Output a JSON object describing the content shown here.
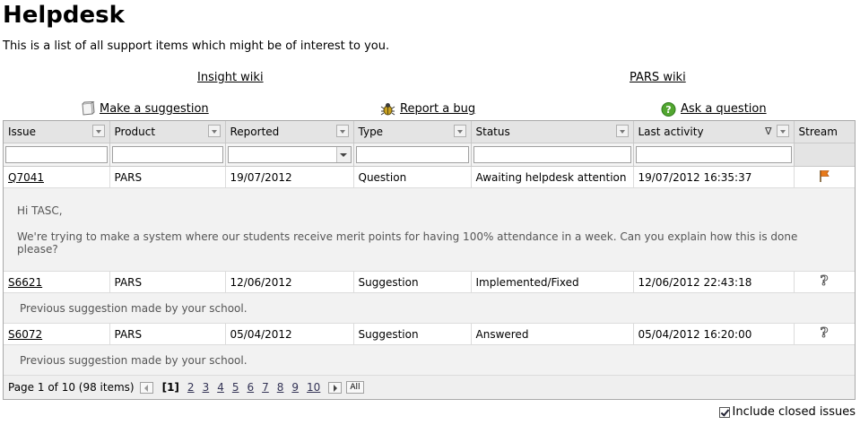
{
  "page": {
    "title": "Helpdesk",
    "intro": "This is a list of all support items which might be of interest to you."
  },
  "links": {
    "insight_wiki": "Insight wiki",
    "pars_wiki": "PARS wiki"
  },
  "actions": {
    "suggestion": "Make a suggestion",
    "bug": "Report a bug",
    "question": "Ask a question"
  },
  "columns": {
    "issue": "Issue",
    "product": "Product",
    "reported": "Reported",
    "type": "Type",
    "status": "Status",
    "last_activity": "Last activity",
    "stream": "Stream"
  },
  "sort_indicator": "∇",
  "rows": [
    {
      "issue": "Q7041",
      "product": "PARS",
      "reported": "19/07/2012",
      "type": "Question",
      "status": "Awaiting helpdesk attention",
      "last_activity": "19/07/2012 16:35:37",
      "stream_icon": "flag-icon",
      "detail_line1": "Hi TASC,",
      "detail_line2": "We're trying to make a system where our students receive merit points for having 100% attendance in a week. Can you explain how this is done please?"
    },
    {
      "issue": "S6621",
      "product": "PARS",
      "reported": "12/06/2012",
      "type": "Suggestion",
      "status": "Implemented/Fixed",
      "last_activity": "12/06/2012 22:43:18",
      "stream_icon": "question-mark-icon",
      "detail": "Previous suggestion made by your school."
    },
    {
      "issue": "S6072",
      "product": "PARS",
      "reported": "05/04/2012",
      "type": "Suggestion",
      "status": "Answered",
      "last_activity": "05/04/2012 16:20:00",
      "stream_icon": "question-mark-icon",
      "detail": "Previous suggestion made by your school."
    }
  ],
  "pager": {
    "info": "Page 1 of 10 (98 items)",
    "current": "[1]",
    "pages": [
      "2",
      "3",
      "4",
      "5",
      "6",
      "7",
      "8",
      "9",
      "10"
    ],
    "all": "All"
  },
  "include_closed": {
    "label": "Include closed issues",
    "checked": true
  }
}
